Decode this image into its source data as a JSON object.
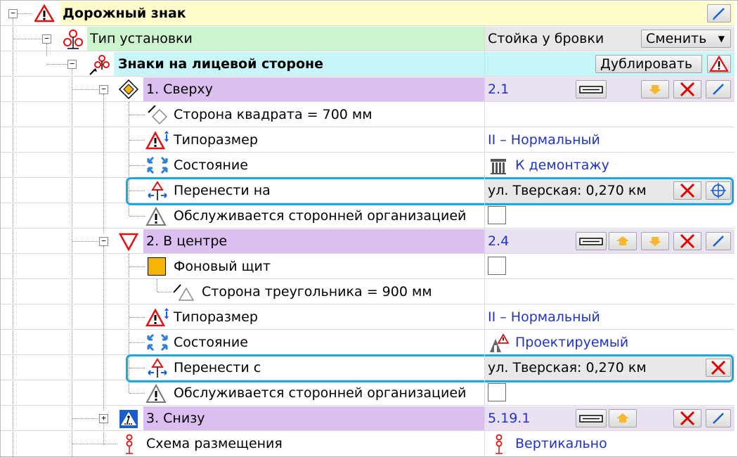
{
  "root": {
    "label": "Дорожный знак"
  },
  "install": {
    "label": "Тип установки",
    "value": "Стойка у бровки",
    "change_button": "Сменить"
  },
  "signs_front": {
    "label": "Знаки на лицевой стороне",
    "duplicate_button": "Дублировать"
  },
  "sign1": {
    "label": "1. Сверху",
    "code": "2.1",
    "side": "Сторона квадрата = 700 мм",
    "size_label": "Типоразмер",
    "size_value": "II – Нормальный",
    "state_label": "Состояние",
    "state_value": "К демонтажу",
    "move_label": "Перенести на",
    "move_value": "ул. Тверская: 0,270 км",
    "serviced_label": "Обслуживается сторонней организацией"
  },
  "sign2": {
    "label": "2. В центре",
    "code": "2.4",
    "background_label": "Фоновый щит",
    "side": "Сторона треугольника = 900 мм",
    "size_label": "Типоразмер",
    "size_value": "II – Нормальный",
    "state_label": "Состояние",
    "state_value": "Проектируемый",
    "move_label": "Перенести с",
    "move_value": "ул. Тверская: 0,270 км",
    "serviced_label": "Обслуживается сторонней организацией"
  },
  "sign3": {
    "label": "3. Снизу",
    "code": "5.19.1"
  },
  "layout_scheme": {
    "label": "Схема размещения",
    "value": "Вертикально"
  },
  "colors": {
    "root_bg": "#fffccc",
    "install_bg": "#cdf4cd",
    "signs_bg": "#c8f6f8",
    "sign_label_bg": "#dbbff0",
    "sign_value_bg": "#e9e1f1",
    "value_text": "#1f33c8",
    "highlight": "#1ba7e0",
    "delete_red": "#e00000",
    "arrow_orange": "#f7b733"
  }
}
